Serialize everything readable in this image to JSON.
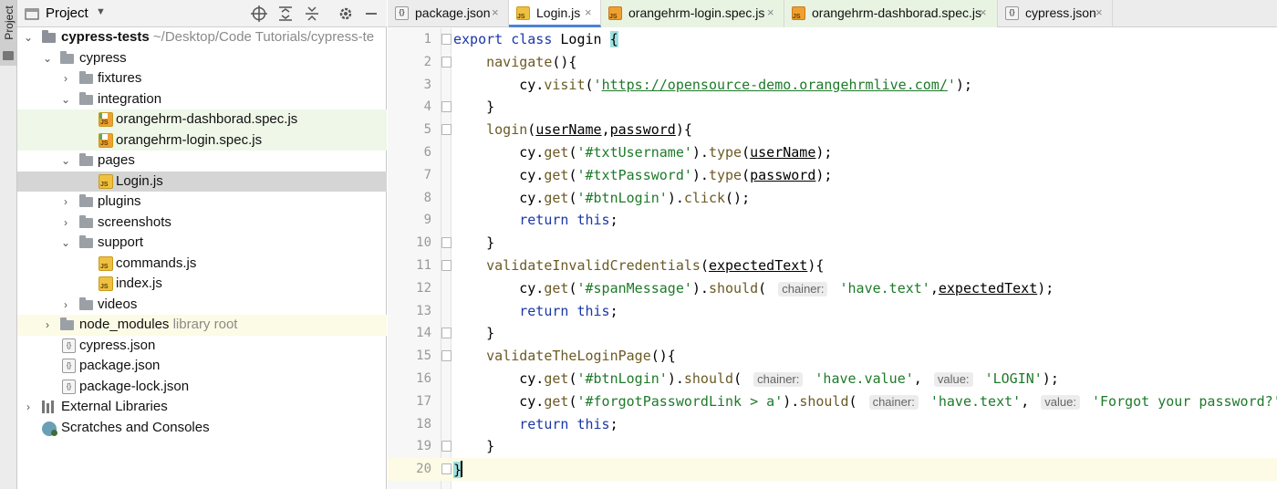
{
  "sidebar_strip": {
    "label": "Project"
  },
  "panel": {
    "title": "Project",
    "tree": [
      {
        "label": "cypress-tests",
        "hint": "~/Desktop/Code Tutorials/cypress-te",
        "icon": "folder-icon"
      },
      {
        "label": "cypress",
        "icon": "folder-icon"
      },
      {
        "label": "fixtures",
        "icon": "folder-icon"
      },
      {
        "label": "integration",
        "icon": "folder-icon"
      },
      {
        "label": "orangehrm-dashborad.spec.js",
        "icon": "js-test-icon"
      },
      {
        "label": "orangehrm-login.spec.js",
        "icon": "js-test-icon"
      },
      {
        "label": "pages",
        "icon": "folder-icon"
      },
      {
        "label": "Login.js",
        "icon": "js-file-icon"
      },
      {
        "label": "plugins",
        "icon": "folder-icon"
      },
      {
        "label": "screenshots",
        "icon": "folder-icon"
      },
      {
        "label": "support",
        "icon": "folder-icon"
      },
      {
        "label": "commands.js",
        "icon": "js-file-icon"
      },
      {
        "label": "index.js",
        "icon": "js-file-icon"
      },
      {
        "label": "videos",
        "icon": "folder-icon"
      },
      {
        "label": "node_modules",
        "hint": "library root",
        "icon": "folder-icon"
      },
      {
        "label": "cypress.json",
        "icon": "json-file-icon"
      },
      {
        "label": "package.json",
        "icon": "json-file-icon"
      },
      {
        "label": "package-lock.json",
        "icon": "json-file-icon"
      },
      {
        "label": "External Libraries",
        "icon": "libraries-icon"
      },
      {
        "label": "Scratches and Consoles",
        "icon": "scratches-icon"
      }
    ]
  },
  "tabs": [
    {
      "label": "package.json",
      "icon": "json-file-icon"
    },
    {
      "label": "Login.js",
      "icon": "js-file-icon",
      "active": true
    },
    {
      "label": "orangehrm-login.spec.js",
      "icon": "js-test-icon"
    },
    {
      "label": "orangehrm-dashborad.spec.js",
      "icon": "js-test-icon"
    },
    {
      "label": "cypress.json",
      "icon": "json-file-icon"
    }
  ],
  "close_glyph": "×",
  "editor": {
    "line_numbers": [
      "1",
      "2",
      "3",
      "4",
      "5",
      "6",
      "7",
      "8",
      "9",
      "10",
      "11",
      "12",
      "13",
      "14",
      "15",
      "16",
      "17",
      "18",
      "19",
      "20"
    ],
    "lines": [
      "export class Login {",
      "    navigate(){",
      "        cy.visit('https://opensource-demo.orangehrmlive.com/');",
      "    }",
      "    login(userName,password){",
      "        cy.get('#txtUsername').type(userName);",
      "        cy.get('#txtPassword').type(password);",
      "        cy.get('#btnLogin').click();",
      "        return this;",
      "    }",
      "    validateInvalidCredentials(expectedText){",
      "        cy.get('#spanMessage').should( chainer: 'have.text',expectedText);",
      "        return this;",
      "    }",
      "    validateTheLoginPage(){",
      "        cy.get('#btnLogin').should( chainer: 'have.value', value: 'LOGIN');",
      "        cy.get('#forgotPasswordLink > a').should( chainer: 'have.text', value: 'Forgot your password?');",
      "        return this;",
      "    }",
      "}"
    ],
    "current_line": "20"
  },
  "colors": {
    "keyword": "#1b37a8",
    "string": "#1e7a2a",
    "method": "#6b5a25",
    "selection": "#d5d5d5",
    "active_tab_underline": "#4b82d6"
  }
}
